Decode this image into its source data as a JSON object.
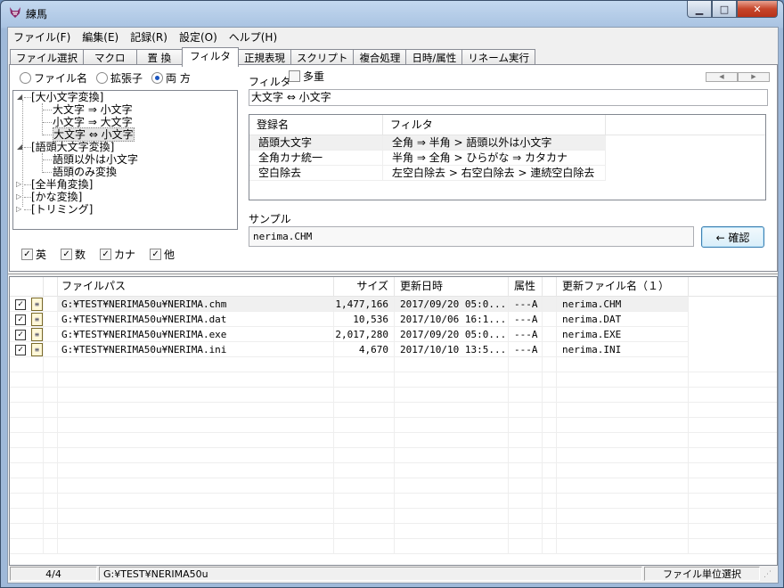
{
  "window": {
    "title": "練馬",
    "minimize": "▁",
    "maximize": "□",
    "close": "✕",
    "app_icon": "fox-icon"
  },
  "menu": [
    "ファイル(F)",
    "編集(E)",
    "記録(R)",
    "設定(O)",
    "ヘルプ(H)"
  ],
  "tabs": [
    "ファイル選択",
    "マクロ",
    "置 換",
    "フィルタ",
    "正規表現",
    "スクリプト",
    "複合処理",
    "日時/属性",
    "リネーム実行"
  ],
  "active_tab": "フィルタ",
  "scope_radios": [
    {
      "label": "ファイル名",
      "checked": false
    },
    {
      "label": "拡張子",
      "checked": false
    },
    {
      "label": "両 方",
      "checked": true
    }
  ],
  "tree": {
    "expand_open": "◢",
    "expand_closed": "▷",
    "groups": [
      {
        "label": "[大小文字変換]",
        "expanded": true,
        "children": [
          "大文字 ⇒ 小文字",
          "小文字 ⇒ 大文字",
          "大文字 ⇔ 小文字"
        ]
      },
      {
        "label": "[語頭大文字変換]",
        "expanded": true,
        "children": [
          "語頭以外は小文字",
          "語頭のみ変換"
        ]
      },
      {
        "label": "[全半角変換]",
        "expanded": false,
        "children": []
      },
      {
        "label": "[かな変換]",
        "expanded": false,
        "children": []
      },
      {
        "label": "[トリミング]",
        "expanded": false,
        "children": []
      }
    ],
    "selected": "大文字 ⇔ 小文字"
  },
  "char_checks": [
    {
      "label": "英",
      "checked": true
    },
    {
      "label": "数",
      "checked": true
    },
    {
      "label": "カナ",
      "checked": true
    },
    {
      "label": "他",
      "checked": true
    }
  ],
  "filter": {
    "label": "フィルタ",
    "multi_label": "多重",
    "multi_checked": false,
    "value": "大文字 ⇔ 小文字",
    "arrow_left": "◀",
    "arrow_right": "▶"
  },
  "registered": {
    "headers": [
      "登録名",
      "フィルタ"
    ],
    "rows": [
      [
        "語頭大文字",
        "全角 ⇒ 半角 > 語頭以外は小文字"
      ],
      [
        "全角カナ統一",
        "半角 ⇒ 全角 > ひらがな ⇒ カタカナ"
      ],
      [
        "空白除去",
        "左空白除去 > 右空白除去 > 連続空白除去"
      ]
    ]
  },
  "sample": {
    "label": "サンプル",
    "value": "nerima.CHM",
    "confirm_label": "← 確認"
  },
  "files": {
    "headers": [
      "ファイルパス",
      "サイズ",
      "更新日時",
      "属性",
      "更新ファイル名（１）"
    ],
    "rows": [
      {
        "checked": true,
        "path": "G:¥TEST¥NERIMA50u¥NERIMA.chm",
        "size": "1,477,166",
        "date": "2017/09/20 05:0...",
        "attr": "---A",
        "newname": "nerima.CHM"
      },
      {
        "checked": true,
        "path": "G:¥TEST¥NERIMA50u¥NERIMA.dat",
        "size": "10,536",
        "date": "2017/10/06 16:1...",
        "attr": "---A",
        "newname": "nerima.DAT"
      },
      {
        "checked": true,
        "path": "G:¥TEST¥NERIMA50u¥NERIMA.exe",
        "size": "2,017,280",
        "date": "2017/09/20 05:0...",
        "attr": "---A",
        "newname": "nerima.EXE"
      },
      {
        "checked": true,
        "path": "G:¥TEST¥NERIMA50u¥NERIMA.ini",
        "size": "4,670",
        "date": "2017/10/10 13:5...",
        "attr": "---A",
        "newname": "nerima.INI"
      }
    ],
    "row_icon": "file-edit-icon"
  },
  "status": {
    "count": "4/4",
    "path": "G:¥TEST¥NERIMA50u",
    "mode": "ファイル単位選択"
  },
  "colors": {
    "title_gradient_top": "#c3d8ef",
    "selection": "#f0f0f0",
    "close_button": "#c6452a",
    "confirm_border": "#3c7fb1"
  }
}
